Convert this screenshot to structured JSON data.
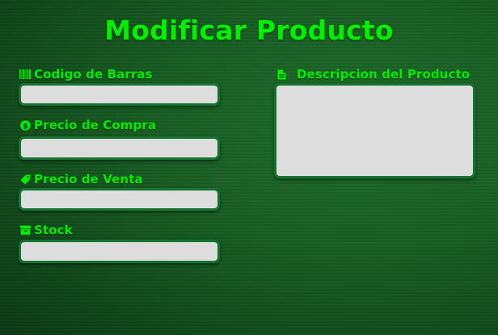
{
  "page": {
    "title": "Modificar Producto"
  },
  "form": {
    "codigo_barras": {
      "label": "Codigo de Barras",
      "value": "",
      "icon": "barcode-icon"
    },
    "precio_compra": {
      "label": "Precio de Compra",
      "value": "",
      "icon": "dollar-icon"
    },
    "precio_venta": {
      "label": "Precio de Venta",
      "value": "",
      "icon": "tag-icon"
    },
    "stock": {
      "label": "Stock",
      "value": "",
      "icon": "archive-box-icon"
    },
    "descripcion": {
      "label": "Descripcion del Producto",
      "value": "",
      "icon": "file-icon"
    }
  },
  "colors": {
    "accent": "#00ee00",
    "field_background": "#dddddd",
    "field_border": "#157530"
  }
}
